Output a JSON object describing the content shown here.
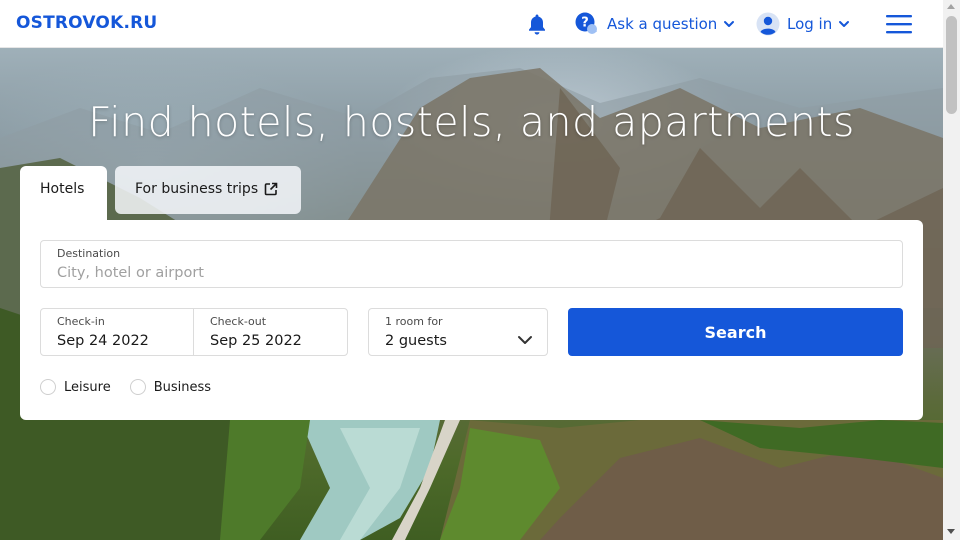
{
  "header": {
    "logo": "OSTROVOK.RU",
    "ask_label": "Ask a question",
    "login_label": "Log in",
    "icons": [
      "bell-icon",
      "question-icon",
      "chevron-down-icon",
      "user-avatar-icon",
      "hamburger-menu-icon"
    ]
  },
  "hero": {
    "title": "Find hotels, hostels, and apartments"
  },
  "tabs": {
    "hotels": "Hotels",
    "business": "For business trips"
  },
  "form": {
    "destination": {
      "label": "Destination",
      "placeholder": "City, hotel or airport"
    },
    "checkin": {
      "label": "Check-in",
      "value": "Sep 24 2022"
    },
    "checkout": {
      "label": "Check-out",
      "value": "Sep 25 2022"
    },
    "guests": {
      "label": "1 room for",
      "value": "2 guests"
    },
    "search_label": "Search",
    "purpose": {
      "leisure": "Leisure",
      "business": "Business"
    }
  },
  "colors": {
    "accent": "#1557d9",
    "white": "#ffffff"
  }
}
